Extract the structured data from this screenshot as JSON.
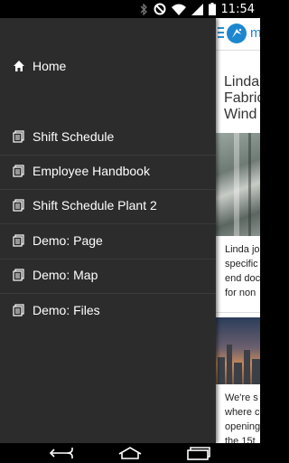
{
  "status_bar": {
    "time": "11:54",
    "icons": [
      "bluetooth-icon",
      "do-not-disturb-icon",
      "wifi-icon",
      "cell-signal-icon",
      "battery-icon"
    ]
  },
  "drawer": {
    "items": [
      {
        "label": "Home",
        "icon": "home-icon"
      },
      {
        "label": "Shift Schedule",
        "icon": "document-icon"
      },
      {
        "label": "Employee Handbook",
        "icon": "document-icon"
      },
      {
        "label": "Shift Schedule Plant 2",
        "icon": "document-icon"
      },
      {
        "label": "Demo: Page",
        "icon": "document-icon"
      },
      {
        "label": "Demo: Map",
        "icon": "document-icon"
      },
      {
        "label": "Demo: Files",
        "icon": "document-icon"
      }
    ]
  },
  "app": {
    "toolbar_text": "m",
    "article_title_lines": [
      "Linda",
      "Fabric",
      "Wind"
    ],
    "excerpt1_lines": [
      "Linda jo",
      "specific",
      "end doc",
      "for non"
    ],
    "excerpt2_lines": [
      "We're s",
      "where c",
      "opening",
      "the 15t"
    ]
  },
  "colors": {
    "drawer_bg": "#2c2c2c",
    "accent": "#1c87cf"
  }
}
